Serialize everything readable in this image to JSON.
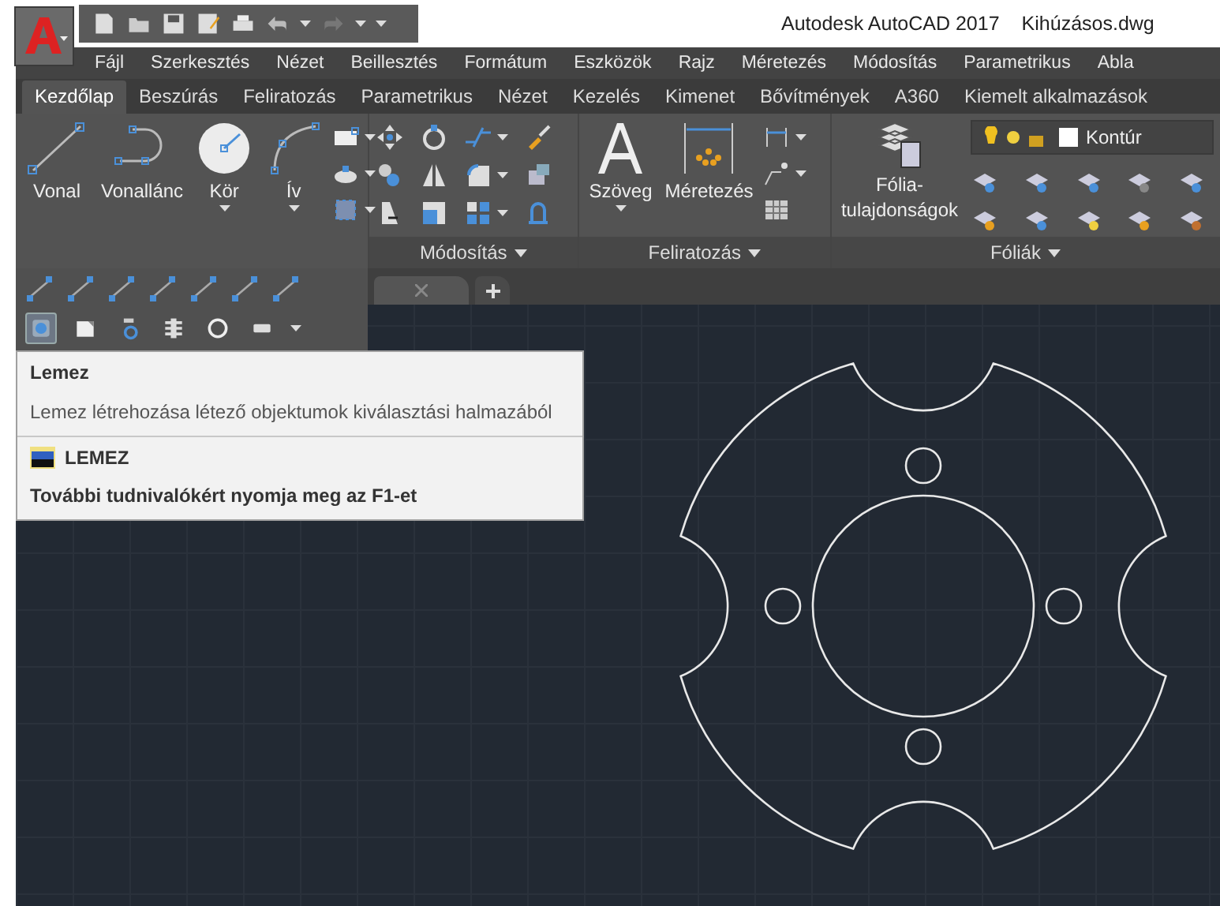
{
  "title_bar": {
    "app": "Autodesk AutoCAD 2017",
    "file": "Kihúzásos.dwg"
  },
  "menu_bar": [
    "Fájl",
    "Szerkesztés",
    "Nézet",
    "Beillesztés",
    "Formátum",
    "Eszközök",
    "Rajz",
    "Méretezés",
    "Módosítás",
    "Parametrikus",
    "Abla"
  ],
  "ribbon_tabs": [
    {
      "label": "Kezdőlap",
      "selected": true
    },
    {
      "label": "Beszúrás",
      "selected": false
    },
    {
      "label": "Feliratozás",
      "selected": false
    },
    {
      "label": "Parametrikus",
      "selected": false
    },
    {
      "label": "Nézet",
      "selected": false
    },
    {
      "label": "Kezelés",
      "selected": false
    },
    {
      "label": "Kimenet",
      "selected": false
    },
    {
      "label": "Bővítmények",
      "selected": false
    },
    {
      "label": "A360",
      "selected": false
    },
    {
      "label": "Kiemelt alkalmazások",
      "selected": false
    }
  ],
  "ribbon": {
    "draw": {
      "tools": [
        {
          "label": "Vonal",
          "kind": "line",
          "dropdown": false
        },
        {
          "label": "Vonallánc",
          "kind": "polyline",
          "dropdown": false
        },
        {
          "label": "Kör",
          "kind": "circle",
          "dropdown": true
        },
        {
          "label": "Ív",
          "kind": "arc",
          "dropdown": true
        }
      ]
    },
    "modify": {
      "title": "Módosítás"
    },
    "annotation": {
      "title": "Feliratozás",
      "tools": [
        {
          "label": "Szöveg",
          "kind": "text",
          "dropdown": true
        },
        {
          "label": "Méretezés",
          "kind": "dimension",
          "dropdown": false
        }
      ]
    },
    "layers": {
      "title": "Fóliák",
      "properties_label_lines": [
        "Fólia-",
        "tulajdonságok"
      ],
      "current_layer": "Kontúr"
    }
  },
  "side_toolbar": [
    {
      "highlighted": true
    },
    {
      "highlighted": false
    },
    {
      "highlighted": false
    },
    {
      "highlighted": false
    },
    {
      "highlighted": false
    },
    {
      "highlighted": false
    }
  ],
  "tooltip": {
    "title": "Lemez",
    "description": "Lemez létrehozása létező objektumok kiválasztási halmazából",
    "command": "LEMEZ",
    "help": "További tudnivalókért nyomja meg az F1-et"
  }
}
